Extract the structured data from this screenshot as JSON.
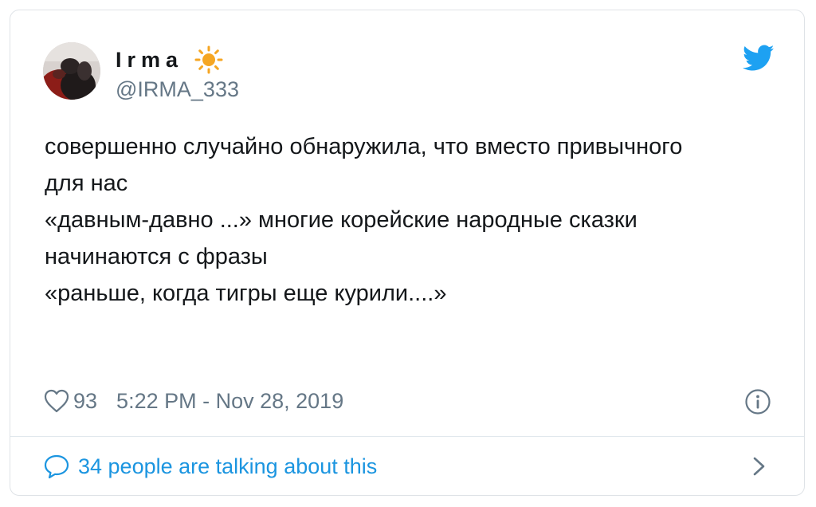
{
  "author": {
    "display_name": "Irma",
    "handle": "@IRMA_333",
    "avatar_icon": "user-avatar",
    "name_emoji_icon": "sun-icon"
  },
  "tweet": {
    "text_lines": [
      "совершенно случайно обнаружила, что вместо привычного",
      "для нас",
      "«давным-давно ...» многие корейские народные сказки",
      "начинаются с фразы",
      "«раньше, когда тигры еще курили....»"
    ]
  },
  "meta": {
    "likes": "93",
    "timestamp": "5:22 PM - Nov 28, 2019"
  },
  "footer": {
    "conversation_label": "34 people are talking about this"
  },
  "colors": {
    "brand_blue": "#1da1f2",
    "link_blue": "#1b95e0",
    "text_primary": "#14171a",
    "text_secondary": "#657786",
    "sun_yellow": "#f5a623"
  }
}
